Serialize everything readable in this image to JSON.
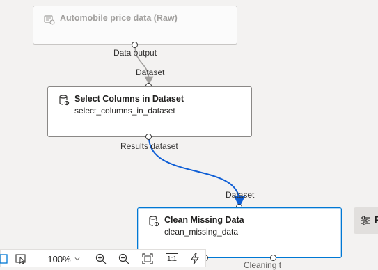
{
  "nodes": {
    "dataset": {
      "title": "Automobile price data (Raw)"
    },
    "select": {
      "title": "Select Columns in Dataset",
      "subtitle": "select_columns_in_dataset"
    },
    "clean": {
      "title": "Clean Missing Data",
      "subtitle": "clean_missing_data"
    }
  },
  "ports": {
    "data_output": "Data output",
    "select_input": "Dataset",
    "results_dataset": "Results dataset",
    "clean_input": "Dataset",
    "clean_output_right": "Cleaning t"
  },
  "side_panel": {
    "label": "P",
    "icon": "settings-sliders-icon"
  },
  "toolbar": {
    "zoom": "100%",
    "fit_ratio_label": "1:1",
    "icons": [
      "panel-icon",
      "pointer-select-icon",
      "chevron-down-icon",
      "zoom-in-icon",
      "zoom-out-icon",
      "fit-to-screen-icon",
      "actual-size-icon",
      "auto-layout-icon"
    ]
  },
  "colors": {
    "selected": "#0078d4",
    "edge_active": "#0f5fd6",
    "edge_inactive": "#a19f9d"
  }
}
